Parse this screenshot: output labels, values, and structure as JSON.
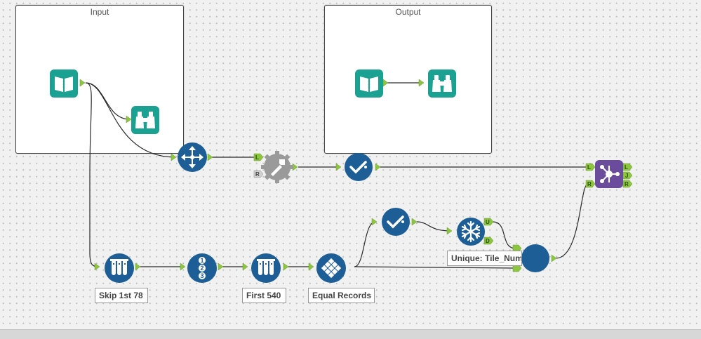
{
  "containers": {
    "input_title": "Input",
    "output_title": "Output"
  },
  "annotations": {
    "skip": "Skip 1st 78",
    "first": "First 540",
    "equal": "Equal Records",
    "unique": "Unique: Tile_Num"
  },
  "anchors": {
    "L": "L",
    "R": "R",
    "J": "J",
    "U": "U",
    "D": "D"
  },
  "tools": [
    {
      "name": "input-data-tool",
      "icon": "book-icon",
      "color": "#1aa191"
    },
    {
      "name": "browse-tool",
      "icon": "binoculars-icon",
      "color": "#1aa191"
    },
    {
      "name": "select-tool",
      "icon": "move-arrows-icon",
      "color": "#1e5e96"
    },
    {
      "name": "append-fields-tool",
      "icon": "wrench-icon",
      "color": "#9a9a9a"
    },
    {
      "name": "filter-tool",
      "icon": "check-icon",
      "color": "#1e5e96"
    },
    {
      "name": "join-tool",
      "icon": "network-icon",
      "color": "#6a4b9c"
    },
    {
      "name": "sample-tool",
      "icon": "test-tubes-icon",
      "color": "#1e5e96"
    },
    {
      "name": "record-id-tool",
      "icon": "numbers-icon",
      "color": "#1e5e96"
    },
    {
      "name": "tile-tool",
      "icon": "diamond-grid-icon",
      "color": "#1e5e96"
    },
    {
      "name": "unique-tool",
      "icon": "snowflake-icon",
      "color": "#1e5e96"
    },
    {
      "name": "union-tool",
      "icon": "circle-icon",
      "color": "#1e5e96"
    }
  ]
}
